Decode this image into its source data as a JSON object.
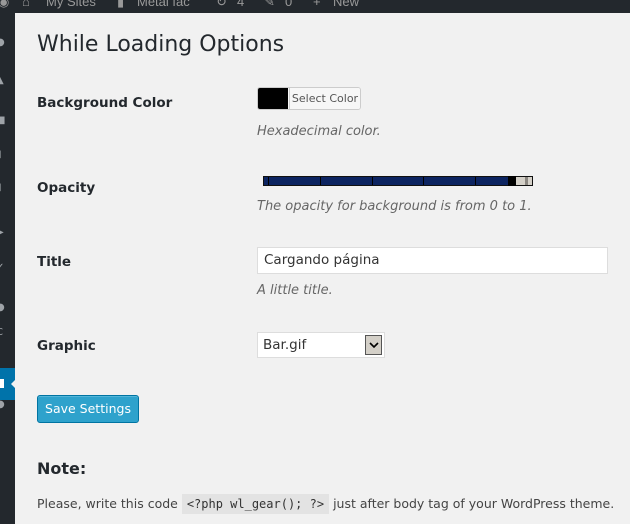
{
  "admin_bar": {
    "items": [
      {
        "icon": "wordpress-icon",
        "label": ""
      },
      {
        "icon": "my-sites-icon",
        "label": "My Sites"
      },
      {
        "icon": "home-icon",
        "label": "Metal fac"
      },
      {
        "icon": "updates-icon",
        "label": "4"
      },
      {
        "icon": "comments-icon",
        "label": "0"
      },
      {
        "icon": "plus-icon",
        "label": "New"
      }
    ]
  },
  "sidebar": {
    "icons": [
      "dashboard-icon",
      "posts-icon",
      "media-icon",
      "pages-icon",
      "comments-icon",
      "appearance-icon",
      "plugins-icon",
      "users-icon",
      "tools-icon",
      "settings-icon",
      "collapse-icon"
    ],
    "active_icon": "settings-icon"
  },
  "page": {
    "title": "While Loading Options"
  },
  "fields": {
    "background_color": {
      "label": "Background Color",
      "button_label": "Select Color",
      "value": "#000000",
      "description": "Hexadecimal color."
    },
    "opacity": {
      "label": "Opacity",
      "value": 0.91,
      "fill_color": "#0c2461",
      "description": "The opacity for background is from 0 to 1."
    },
    "title": {
      "label": "Title",
      "value": "Cargando página",
      "description": "A little title."
    },
    "graphic": {
      "label": "Graphic",
      "selected": "Bar.gif"
    }
  },
  "actions": {
    "save_label": "Save Settings",
    "accent": "#2ea2cc"
  },
  "note": {
    "heading": "Note:",
    "before": "Please, write this code ",
    "code": "<?php wl_gear(); ?>",
    "after": " just after body tag of your WordPress theme."
  }
}
